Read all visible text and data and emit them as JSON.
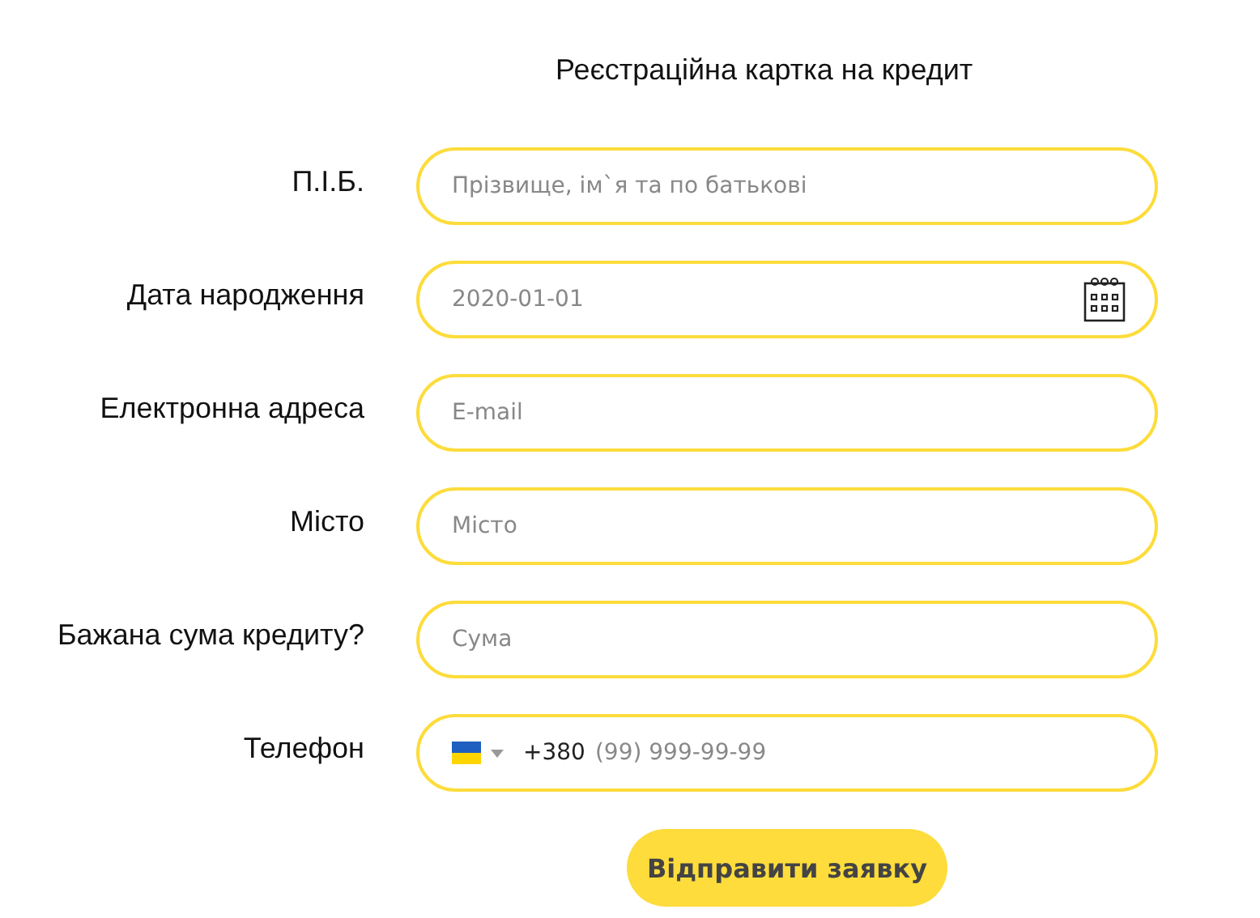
{
  "title": "Реєстраційна картка на кредит",
  "fields": [
    {
      "kind": "text",
      "label": "П.І.Б.",
      "placeholder": "Прізвище, ім`я та по батькові"
    },
    {
      "kind": "date",
      "label": "Дата народження",
      "placeholder": "2020-01-01"
    },
    {
      "kind": "text",
      "label": "Електронна адреса",
      "placeholder": "E-mail"
    },
    {
      "kind": "text",
      "label": "Місто",
      "placeholder": "Місто"
    },
    {
      "kind": "text",
      "label": "Бажана сума кредиту?",
      "placeholder": "Сума"
    },
    {
      "kind": "phone",
      "label": "Телефон",
      "prefix": "+380",
      "placeholder": "(99) 999-99-99"
    }
  ],
  "submit": "Відправити заявку"
}
